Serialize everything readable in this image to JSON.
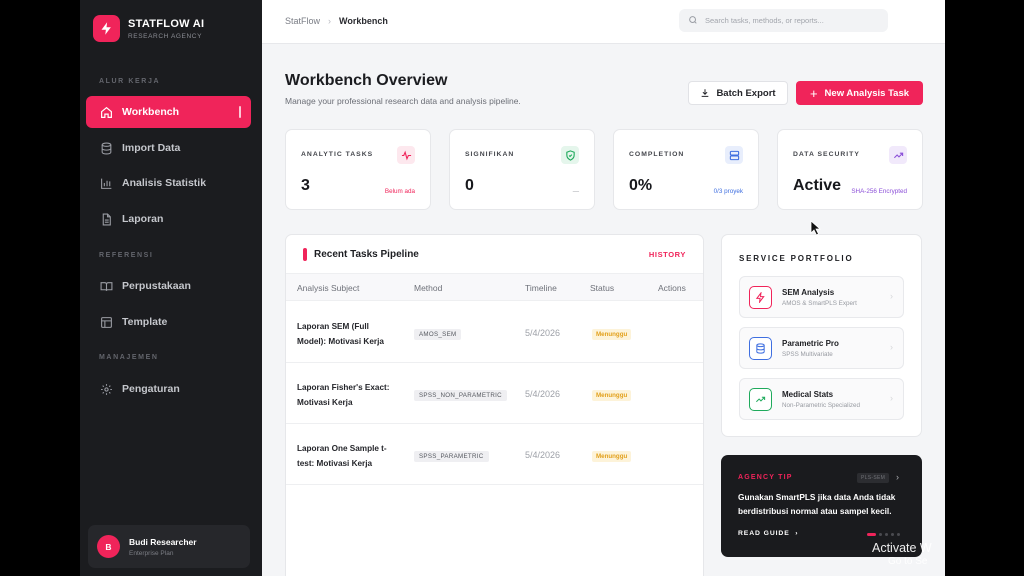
{
  "brand": {
    "name": "STATFLOW AI",
    "subtitle": "RESEARCH AGENCY",
    "color": "#f0245a"
  },
  "sidebar": {
    "sections": [
      {
        "label": "ALUR KERJA"
      },
      {
        "label": "REFERENSI"
      },
      {
        "label": "MANAJEMEN"
      }
    ],
    "items": [
      {
        "label": "Workbench",
        "icon": "home-icon",
        "active": true
      },
      {
        "label": "Import Data",
        "icon": "database-icon"
      },
      {
        "label": "Analisis Statistik",
        "icon": "bar-chart-icon"
      },
      {
        "label": "Laporan",
        "icon": "document-icon"
      },
      {
        "label": "Perpustakaan",
        "icon": "book-icon"
      },
      {
        "label": "Template",
        "icon": "layout-icon"
      },
      {
        "label": "Pengaturan",
        "icon": "gear-icon"
      }
    ],
    "user": {
      "initial": "B",
      "name": "Budi Researcher",
      "plan": "Enterprise Plan"
    }
  },
  "topbar": {
    "breadcrumb": [
      "StatFlow",
      "Workbench"
    ],
    "search_placeholder": "Search tasks, methods, or reports..."
  },
  "header": {
    "title": "Workbench Overview",
    "subtitle": "Manage your professional research data and analysis pipeline.",
    "export_label": "Batch Export",
    "new_label": "New Analysis Task"
  },
  "stats": [
    {
      "label": "ANALYTIC TASKS",
      "value": "3",
      "note": "Belum ada",
      "note_color": "#f0245a",
      "icon": "pulse-icon",
      "icon_color": "#f0245a",
      "icon_bg": "#fde8ee"
    },
    {
      "label": "SIGNIFIKAN",
      "value": "0",
      "note": "—",
      "note_color": "#9a9ca3",
      "icon": "shield-check-icon",
      "icon_color": "#1faa5c",
      "icon_bg": "#e5f6ec"
    },
    {
      "label": "COMPLETION",
      "value": "0%",
      "note": "0/3 proyek",
      "note_color": "#3f6fe0",
      "icon": "server-icon",
      "icon_color": "#3f6fe0",
      "icon_bg": "#e8eefc"
    },
    {
      "label": "DATA SECURITY",
      "value": "Active",
      "note": "SHA-256 Encrypted",
      "note_color": "#8b4fd8",
      "icon": "trend-up-icon",
      "icon_color": "#8b4fd8",
      "icon_bg": "#f1e9fb"
    }
  ],
  "tasks": {
    "title": "Recent Tasks Pipeline",
    "history_label": "HISTORY",
    "columns": [
      "Analysis Subject",
      "Method",
      "Timeline",
      "Status",
      "Actions"
    ],
    "rows": [
      {
        "subject": "Laporan SEM (Full Model): Motivasi Kerja",
        "method": "AMOS_SEM",
        "timeline": "5/4/2026",
        "status": "Menunggu"
      },
      {
        "subject": "Laporan Fisher's Exact: Motivasi Kerja",
        "method": "SPSS_NON_PARAMETRIC",
        "timeline": "5/4/2026",
        "status": "Menunggu"
      },
      {
        "subject": "Laporan One Sample t-test: Motivasi Kerja",
        "method": "SPSS_PARAMETRIC",
        "timeline": "5/4/2026",
        "status": "Menunggu"
      }
    ]
  },
  "portfolio": {
    "title": "SERVICE PORTFOLIO",
    "services": [
      {
        "name": "SEM Analysis",
        "desc": "AMOS & SmartPLS Expert",
        "icon": "lightning-icon",
        "color": "#f0245a"
      },
      {
        "name": "Parametric Pro",
        "desc": "SPSS Multivariate",
        "icon": "database-icon",
        "color": "#3f6fe0"
      },
      {
        "name": "Medical Stats",
        "desc": "Non-Parametric Specialized",
        "icon": "trend-up-icon",
        "color": "#1faa5c"
      }
    ]
  },
  "tip": {
    "label": "AGENCY TIP",
    "tag": "PLS-SEM",
    "text": "Gunakan SmartPLS jika data Anda tidak berdistribusi normal atau sampel kecil.",
    "guide_label": "READ GUIDE",
    "slides": 5,
    "current_slide": 1
  },
  "watermark": {
    "line1": "Activate W",
    "line2": "Go to Se"
  }
}
